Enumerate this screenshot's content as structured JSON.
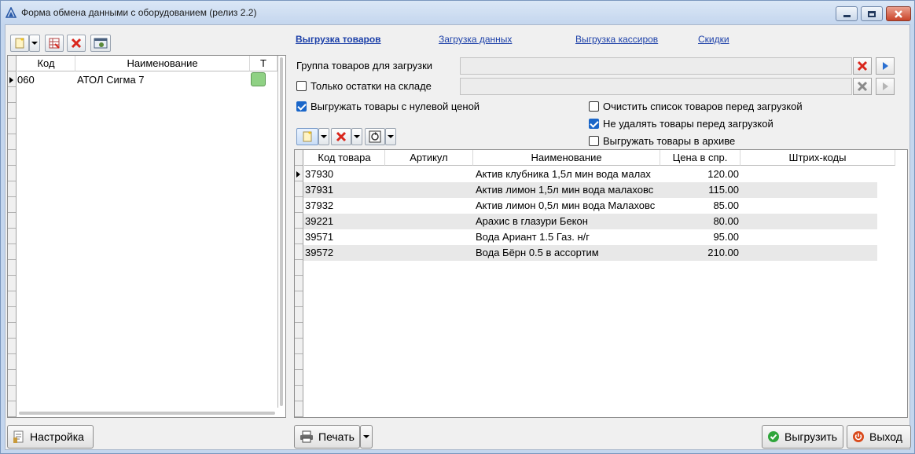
{
  "window": {
    "title": "Форма обмена данными с оборудованием (релиз 2.2)"
  },
  "left_panel": {
    "columns": [
      "Код",
      "Наименование",
      "Т"
    ],
    "rows": [
      {
        "code": "060",
        "name": "АТОЛ Сигма 7",
        "t_color": "#8fd184"
      }
    ],
    "settings_button": "Настройка"
  },
  "tabs": [
    {
      "label": "Выгрузка товаров",
      "active": true
    },
    {
      "label": "Загрузка данных",
      "active": false
    },
    {
      "label": "Выгрузка кассиров",
      "active": false
    },
    {
      "label": "Скидки",
      "active": false
    }
  ],
  "form": {
    "group_label": "Группа товаров для загрузки",
    "only_stock_label": "Только остатки на складе",
    "only_stock_checked": false,
    "zero_price_label": "Выгружать товары с нулевой ценой",
    "zero_price_checked": true,
    "clear_list_label": "Очистить список товаров перед загрузкой",
    "clear_list_checked": false,
    "no_delete_label": "Не удалять товары перед загрузкой",
    "no_delete_checked": true,
    "archive_label": "Выгружать товары в архиве",
    "archive_checked": false
  },
  "goods_grid": {
    "columns": [
      "Код товара",
      "Артикул",
      "Наименование",
      "Цена в спр.",
      "Штрих-коды"
    ],
    "rows": [
      {
        "code": "37930",
        "article": "",
        "name": "Актив  клубника 1,5л мин вода малах",
        "price": "120.00",
        "barcodes": ""
      },
      {
        "code": "37931",
        "article": "",
        "name": "Актив  лимон 1,5л мин вода малаховс",
        "price": "115.00",
        "barcodes": ""
      },
      {
        "code": "37932",
        "article": "",
        "name": "Актив лимон 0,5л мин вода Малаховс",
        "price": "85.00",
        "barcodes": ""
      },
      {
        "code": "39221",
        "article": "",
        "name": "Арахис в глазури Бекон",
        "price": "80.00",
        "barcodes": ""
      },
      {
        "code": "39571",
        "article": "",
        "name": "Вода Ариант 1.5 Газ. н/г",
        "price": "95.00",
        "barcodes": ""
      },
      {
        "code": "39572",
        "article": "",
        "name": "Вода Бёрн 0.5 в ассортим",
        "price": "210.00",
        "barcodes": ""
      }
    ]
  },
  "footer": {
    "print_button": "Печать",
    "export_button": "Выгрузить",
    "exit_button": "Выход"
  },
  "colors": {
    "link": "#1b3fa8",
    "accent_red": "#d9261c",
    "accent_green": "#2fa53b"
  }
}
